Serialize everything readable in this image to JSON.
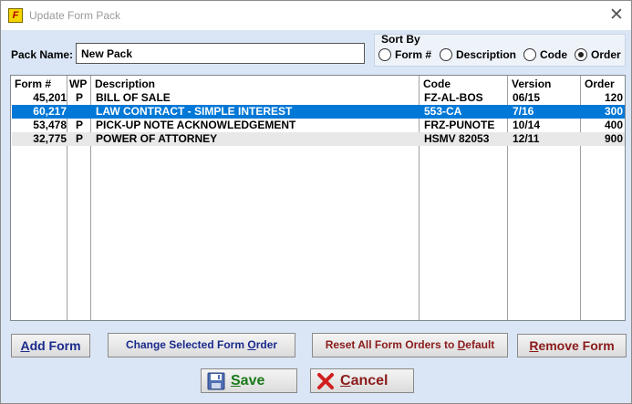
{
  "window": {
    "title": "Update Form Pack",
    "icon_glyph": "F",
    "close_glyph": "✕"
  },
  "pack": {
    "label": "Pack Name:",
    "value": "New Pack"
  },
  "sort_by": {
    "title": "Sort By",
    "options": [
      {
        "label": "Form #",
        "checked": false
      },
      {
        "label": "Description",
        "checked": false
      },
      {
        "label": "Code",
        "checked": false
      },
      {
        "label": "Order",
        "checked": true
      }
    ]
  },
  "grid": {
    "columns": [
      "Form #",
      "WP",
      "Description",
      "Code",
      "Version",
      "Order"
    ],
    "rows": [
      {
        "form": "45,201",
        "wp": "P",
        "description": "BILL OF SALE",
        "code": "FZ-AL-BOS",
        "version": "06/15",
        "order": "120",
        "selected": false
      },
      {
        "form": "60,217",
        "wp": "",
        "description": "LAW CONTRACT - SIMPLE INTEREST",
        "code": "553-CA",
        "version": "7/16",
        "order": "300",
        "selected": true
      },
      {
        "form": "53,478",
        "wp": "P",
        "description": "PICK-UP NOTE ACKNOWLEDGEMENT",
        "code": "FRZ-PUNOTE",
        "version": "10/14",
        "order": "400",
        "selected": false
      },
      {
        "form": "32,775",
        "wp": "P",
        "description": "POWER OF ATTORNEY",
        "code": "HSMV 82053",
        "version": "12/11",
        "order": "900",
        "selected": false
      }
    ]
  },
  "buttons": {
    "add_form": {
      "mnemonic": "A",
      "rest": "dd Form"
    },
    "change_order": {
      "pre": "Change Selected Form ",
      "mnemonic": "O",
      "rest": "rder"
    },
    "reset_orders": {
      "pre": "Reset All Form Orders to ",
      "mnemonic": "D",
      "rest": "efault"
    },
    "remove_form": {
      "mnemonic": "R",
      "rest": "emove Form"
    },
    "save": {
      "mnemonic": "S",
      "rest": "ave",
      "icon": "floppy-disk-icon"
    },
    "cancel": {
      "mnemonic": "C",
      "rest": "ancel",
      "icon": "red-x-icon"
    }
  },
  "colors": {
    "selection": "#0078d7",
    "window_bg": "#dae6f5",
    "save_text": "#1a7a1a",
    "cancel_text": "#8b1a1a"
  }
}
